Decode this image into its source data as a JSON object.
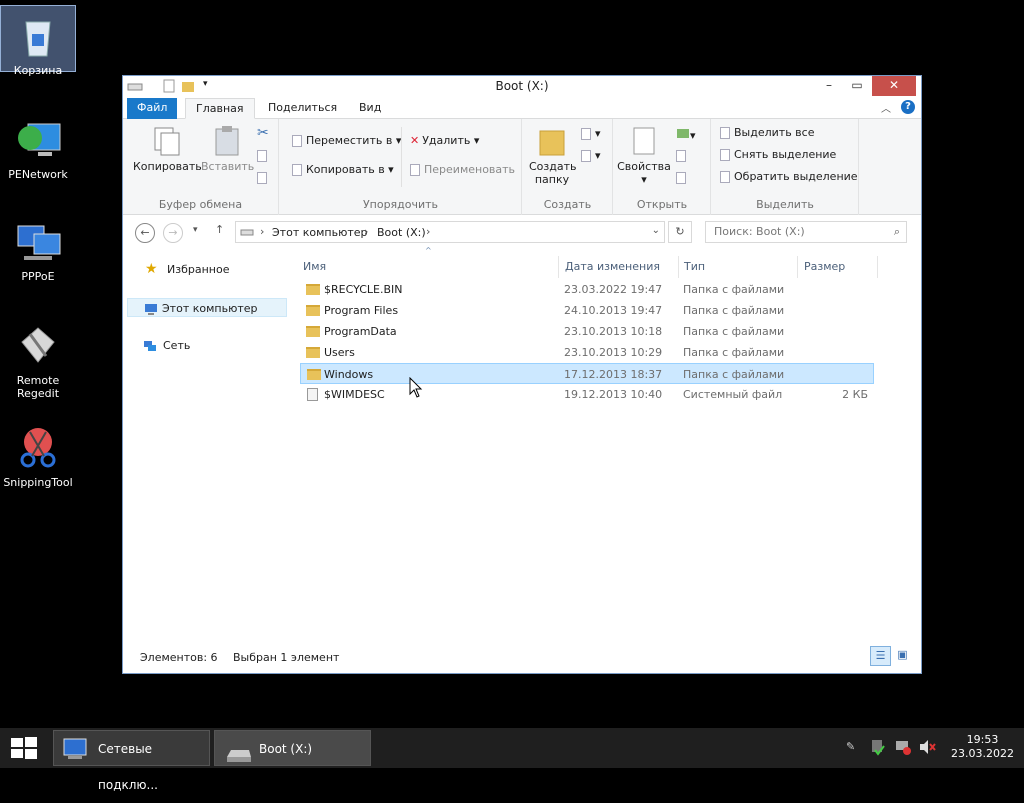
{
  "desktop": {
    "icons": [
      {
        "label": "Корзина"
      },
      {
        "label": "PENetwork"
      },
      {
        "label": "PPPoE"
      },
      {
        "label": "Remote Regedit"
      },
      {
        "label": "SnippingTool"
      }
    ]
  },
  "window": {
    "title": "Boot (X:)",
    "tabs": [
      "Файл",
      "Главная",
      "Поделиться",
      "Вид"
    ],
    "ribbon": {
      "clipboard": {
        "label": "Буфер обмена",
        "copy": "Копировать",
        "paste": "Вставить"
      },
      "organize": {
        "label": "Упорядочить",
        "move": "Переместить в",
        "copy_to": "Копировать в",
        "delete": "Удалить",
        "rename": "Переименовать"
      },
      "create": {
        "label": "Создать",
        "new_folder": "Создать папку"
      },
      "open": {
        "label": "Открыть",
        "properties": "Свойства"
      },
      "select": {
        "label": "Выделить",
        "select_all": "Выделить все",
        "select_none": "Снять выделение",
        "invert": "Обратить выделение"
      }
    },
    "address": {
      "crumbs": [
        "Этот компьютер",
        "Boot (X:)"
      ],
      "search_placeholder": "Поиск: Boot (X:)"
    },
    "nav": {
      "favorites": "Избранное",
      "this_pc": "Этот компьютер",
      "network": "Сеть"
    },
    "columns": {
      "name": "Имя",
      "modified": "Дата изменения",
      "type": "Тип",
      "size": "Размер"
    },
    "files": [
      {
        "name": "$RECYCLE.BIN",
        "modified": "23.03.2022 19:47",
        "type": "Папка с файлами",
        "size": ""
      },
      {
        "name": "Program Files",
        "modified": "24.10.2013 19:47",
        "type": "Папка с файлами",
        "size": ""
      },
      {
        "name": "ProgramData",
        "modified": "23.10.2013 10:18",
        "type": "Папка с файлами",
        "size": ""
      },
      {
        "name": "Users",
        "modified": "23.10.2013 10:29",
        "type": "Папка с файлами",
        "size": ""
      },
      {
        "name": "Windows",
        "modified": "17.12.2013 18:37",
        "type": "Папка с файлами",
        "size": ""
      },
      {
        "name": "$WIMDESC",
        "modified": "19.12.2013 10:40",
        "type": "Системный файл",
        "size": "2 КБ"
      }
    ],
    "status": {
      "count": "Элементов: 6",
      "selected": "Выбран 1 элемент"
    }
  },
  "taskbar": {
    "items": [
      "Сетевые подклю...",
      "Boot (X:)"
    ],
    "time": "19:53",
    "date": "23.03.2022"
  }
}
